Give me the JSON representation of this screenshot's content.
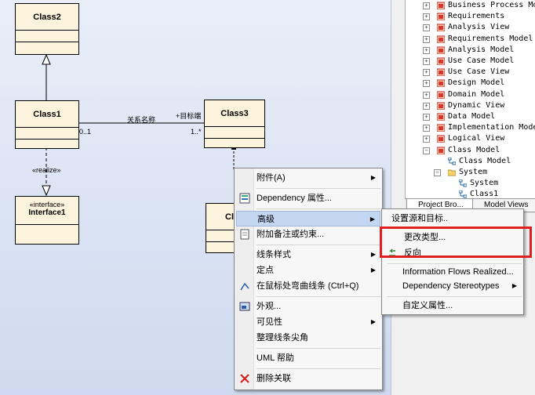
{
  "diagram": {
    "class2": "Class2",
    "class1": "Class1",
    "class3": "Class3",
    "partial_class": "Cl",
    "interface_stereotype": "«interface»",
    "interface_name": "Interface1",
    "realize_label": "«realize»",
    "assoc_name": "关系名称",
    "target_role": "+目标端",
    "mult_source": "0..1",
    "mult_target": "1..*"
  },
  "tree": {
    "items": [
      {
        "label": "Business Process Model",
        "expander": "+",
        "icon": "package-red-icon"
      },
      {
        "label": "Requirements",
        "expander": "+",
        "icon": "package-red-icon"
      },
      {
        "label": "Analysis View",
        "expander": "+",
        "icon": "package-red-icon"
      },
      {
        "label": "Requirements Model",
        "expander": "+",
        "icon": "package-red-icon"
      },
      {
        "label": "Analysis Model",
        "expander": "+",
        "icon": "package-red-icon"
      },
      {
        "label": "Use Case Model",
        "expander": "+",
        "icon": "package-red-icon"
      },
      {
        "label": "Use Case View",
        "expander": "+",
        "icon": "package-red-icon"
      },
      {
        "label": "Design Model",
        "expander": "+",
        "icon": "package-red-icon"
      },
      {
        "label": "Domain Model",
        "expander": "+",
        "icon": "package-red-icon"
      },
      {
        "label": "Dynamic View",
        "expander": "+",
        "icon": "package-red-icon"
      },
      {
        "label": "Data Model",
        "expander": "+",
        "icon": "package-red-icon"
      },
      {
        "label": "Implementation Model",
        "expander": "+",
        "icon": "package-red-icon"
      },
      {
        "label": "Logical View",
        "expander": "+",
        "icon": "package-red-icon"
      },
      {
        "label": "Class Model",
        "expander": "−",
        "icon": "package-red-icon"
      },
      {
        "label": "Class Model",
        "expander": "",
        "icon": "class-diagram-icon"
      },
      {
        "label": "System",
        "expander": "−",
        "icon": "folder-icon"
      },
      {
        "label": "System",
        "expander": "",
        "icon": "class-diagram-icon"
      },
      {
        "label": "Class1",
        "expander": "",
        "icon": "class-diagram-icon"
      }
    ]
  },
  "tabs": {
    "project_browser": "Project Bro...",
    "model_views": "Model Views"
  },
  "context_menu": {
    "items": {
      "attachment": "附件(A)",
      "dependency_props": "Dependency 属性...",
      "advanced": "高级",
      "attach_note": "附加备注或约束...",
      "line_style": "线条样式",
      "pinpoint": "定点",
      "bend_line": "在鼠标处弯曲线条 (Ctrl+Q)",
      "appearance": "外观...",
      "visibility": "可见性",
      "tidy_line": "整理线条尖角",
      "uml_help": "UML 帮助",
      "delete_connector": "删除关联"
    }
  },
  "submenu": {
    "items": {
      "set_source_target": "设置源和目标..",
      "change_type": "更改类型...",
      "reverse": "反向",
      "info_flows": "Information Flows Realized...",
      "dep_stereotypes": "Dependency Stereotypes",
      "custom_props": "自定义属性..."
    }
  },
  "colors": {
    "highlight": "#c4d7f2",
    "annotation_box": "#e02020",
    "class_fill": "#fbf3dc"
  }
}
